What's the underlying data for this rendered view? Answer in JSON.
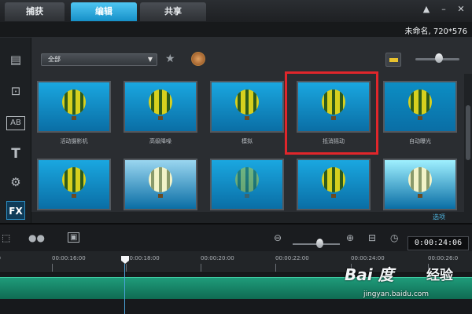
{
  "tabs": [
    {
      "label": "捕获",
      "active": false
    },
    {
      "label": "编辑",
      "active": true
    },
    {
      "label": "共享",
      "active": false
    }
  ],
  "window_icons": [
    "upload-icon",
    "minimize-icon",
    "close-icon"
  ],
  "project_title": "未命名, 720*576",
  "library": {
    "category_dropdown": "全部",
    "sidebar_icons": [
      "media-icon",
      "transition-icon",
      "title-template-icon",
      "title-icon",
      "graphics-icon",
      "fx-icon"
    ],
    "fx_label": "FX",
    "thumbnails": [
      {
        "label": "活动摄影机",
        "bg": "#1aa7e0"
      },
      {
        "label": "高级降噪",
        "bg": "#1aa7e0"
      },
      {
        "label": "模拟",
        "bg": "#1aa7e0"
      },
      {
        "label": "抵消摇动",
        "bg": "#1aa7e0"
      },
      {
        "label": "自动曝光",
        "bg": "#0d8ec4"
      },
      {
        "label": "",
        "bg": "#1aa7e0"
      },
      {
        "label": "",
        "bg": "#9ad6f0"
      },
      {
        "label": "",
        "bg": "#1aa7e0"
      },
      {
        "label": "",
        "bg": "#1aa7e0"
      },
      {
        "label": "",
        "bg": "#9ff0ff"
      }
    ],
    "options_label": "选项"
  },
  "timeline": {
    "timecode": "0:00:24:06",
    "ruler_labels": [
      "00:00:16:00",
      "00:00:18:00",
      "00:00:20:00",
      "00:00:22:00",
      "00:00:24:00",
      "00:00:26:0"
    ]
  },
  "watermark": {
    "brand": "Bai 度",
    "chinese": "经验",
    "url": "jingyan.baidu.com"
  },
  "colors": {
    "active_tab": "#1690c8",
    "highlight_box": "#e0262b",
    "clip": "#16876a",
    "fx_accent": "#2c8cc0"
  }
}
